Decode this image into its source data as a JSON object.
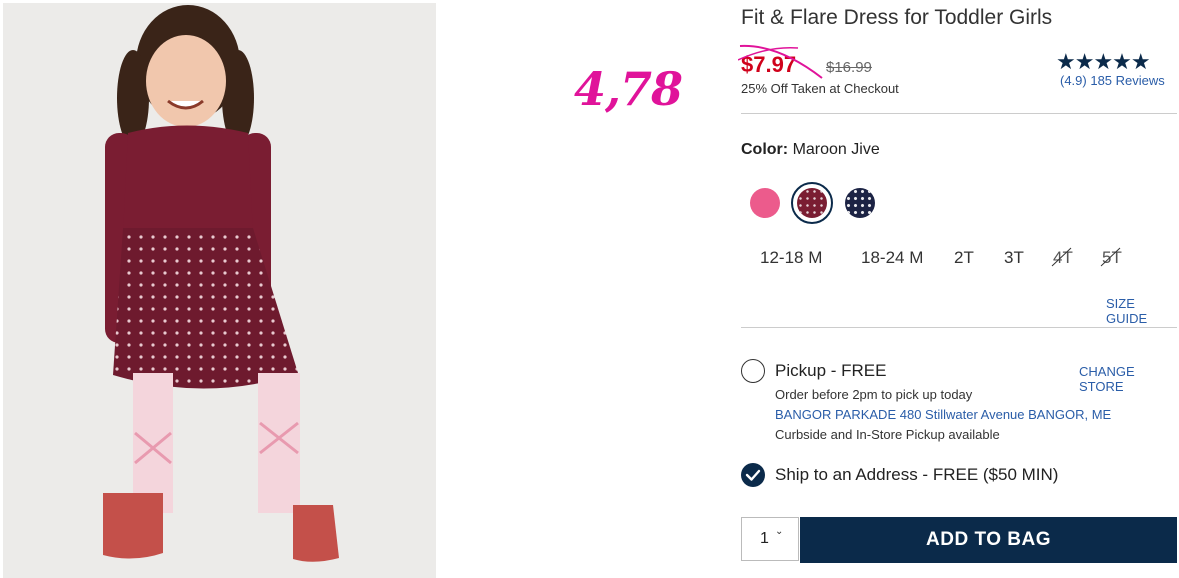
{
  "annotation": "4,78",
  "product": {
    "title": "Fit & Flare Dress for Toddler Girls",
    "sale_price": "$7.97",
    "original_price": "$16.99",
    "promo": "25% Off Taken at Checkout",
    "rating_stars": "★★★★★",
    "rating_value": 4.9,
    "reviews": "(4.9) 185 Reviews"
  },
  "color": {
    "label": "Color:",
    "selected": "Maroon Jive",
    "swatches": [
      {
        "name": "pink",
        "hex": "#ec5b8c"
      },
      {
        "name": "maroon-jive",
        "hex": "#7a1d32",
        "selected": true
      },
      {
        "name": "navy-print",
        "hex": "#1c2344"
      }
    ]
  },
  "sizes": [
    {
      "label": "12-18 M",
      "available": true
    },
    {
      "label": "18-24 M",
      "available": true
    },
    {
      "label": "2T",
      "available": true
    },
    {
      "label": "3T",
      "available": true
    },
    {
      "label": "4T",
      "available": false
    },
    {
      "label": "5T",
      "available": false
    }
  ],
  "size_guide": "SIZE GUIDE",
  "fulfillment": {
    "pickup_label": "Pickup - FREE",
    "change_store": "CHANGE STORE",
    "pickup_note": "Order before 2pm to pick up today",
    "store_address": "BANGOR PARKADE 480 Stillwater Avenue  BANGOR, ME",
    "curbside": "Curbside and In-Store Pickup available",
    "ship_label": "Ship to an Address - FREE ($50 MIN)",
    "ship_selected": true
  },
  "cart": {
    "quantity": "1",
    "add_label": "ADD TO BAG"
  },
  "colors": {
    "brand_navy": "#0b2a4a",
    "sale_red": "#d0021b",
    "annotation_pink": "#e0139a",
    "link_blue": "#2a5da8"
  }
}
